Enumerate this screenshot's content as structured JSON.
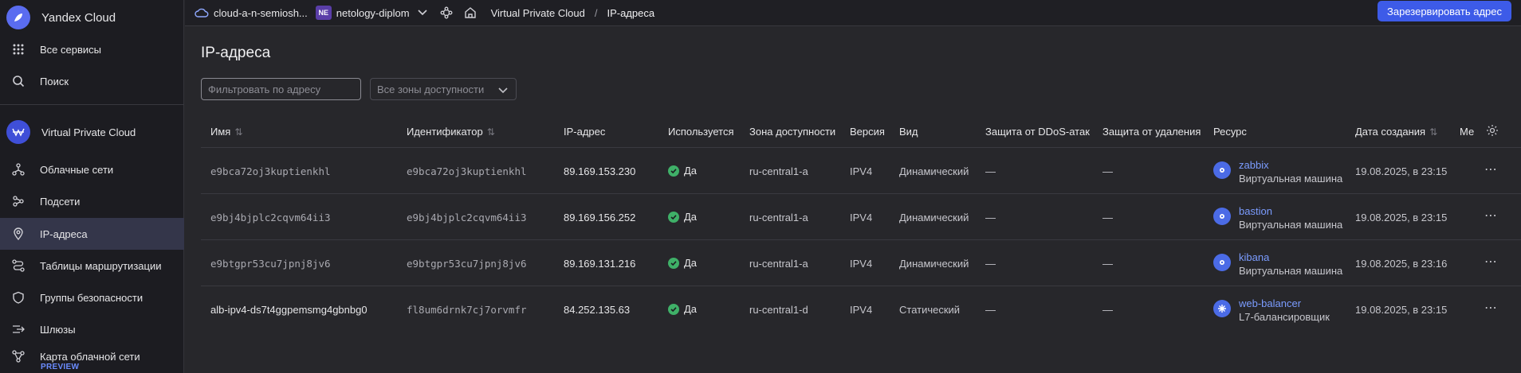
{
  "sidebar": {
    "brand": "Yandex Cloud",
    "all_services": "Все сервисы",
    "search": "Поиск",
    "service": "Virtual Private Cloud",
    "items": [
      {
        "label": "Облачные сети",
        "icon": "network-icon"
      },
      {
        "label": "Подсети",
        "icon": "subnet-icon"
      },
      {
        "label": "IP-адреса",
        "icon": "location-pin-icon",
        "active": true
      },
      {
        "label": "Таблицы маршрутизации",
        "icon": "route-icon"
      },
      {
        "label": "Группы безопасности",
        "icon": "shield-icon"
      },
      {
        "label": "Шлюзы",
        "icon": "gateway-icon"
      },
      {
        "label": "Карта облачной сети",
        "icon": "network-map-icon"
      }
    ],
    "preview_badge": "PREVIEW"
  },
  "topbar": {
    "cloud": "cloud-a-n-semiosh...",
    "folder_badge": "NE",
    "folder": "netology-diplom",
    "breadcrumb_service": "Virtual Private Cloud",
    "breadcrumb_sep": "/",
    "breadcrumb_page": "IP-адреса",
    "reserve_button": "Зарезервировать адрес"
  },
  "main": {
    "title": "IP-адреса",
    "filter_placeholder": "Фильтровать по адресу",
    "zone_select": "Все зоны доступности"
  },
  "table": {
    "headers": {
      "name": "Имя",
      "id": "Идентификатор",
      "ip": "IP-адрес",
      "used": "Используется",
      "zone": "Зона доступности",
      "version": "Версия",
      "kind": "Вид",
      "ddos": "Защита от DDoS-атак",
      "deletion": "Защита от удаления",
      "resource": "Ресурс",
      "created": "Дата создания",
      "me": "Ме"
    },
    "rows": [
      {
        "name": "e9bca72oj3kuptienkhl",
        "name_mono": true,
        "id": "e9bca72oj3kuptienkhl",
        "ip": "89.169.153.230",
        "used": "Да",
        "zone": "ru-central1-a",
        "version": "IPV4",
        "kind": "Динамический",
        "ddos": "—",
        "deletion": "—",
        "resource_name": "zabbix",
        "resource_type": "Виртуальная машина",
        "created": "19.08.2025, в 23:15"
      },
      {
        "name": "e9bj4bjplc2cqvm64ii3",
        "name_mono": true,
        "id": "e9bj4bjplc2cqvm64ii3",
        "ip": "89.169.156.252",
        "used": "Да",
        "zone": "ru-central1-a",
        "version": "IPV4",
        "kind": "Динамический",
        "ddos": "—",
        "deletion": "—",
        "resource_name": "bastion",
        "resource_type": "Виртуальная машина",
        "created": "19.08.2025, в 23:15"
      },
      {
        "name": "e9btgpr53cu7jpnj8jv6",
        "name_mono": true,
        "id": "e9btgpr53cu7jpnj8jv6",
        "ip": "89.169.131.216",
        "used": "Да",
        "zone": "ru-central1-a",
        "version": "IPV4",
        "kind": "Динамический",
        "ddos": "—",
        "deletion": "—",
        "resource_name": "kibana",
        "resource_type": "Виртуальная машина",
        "created": "19.08.2025, в 23:16"
      },
      {
        "name": "alb-ipv4-ds7t4ggpemsmg4gbnbg0",
        "name_mono": false,
        "id": "fl8um6drnk7cj7orvmfr",
        "ip": "84.252.135.63",
        "used": "Да",
        "zone": "ru-central1-d",
        "version": "IPV4",
        "kind": "Статический",
        "ddos": "—",
        "deletion": "—",
        "resource_name": "web-balancer",
        "resource_type": "L7-балансировщик",
        "created": "19.08.2025, в 23:15"
      }
    ]
  }
}
